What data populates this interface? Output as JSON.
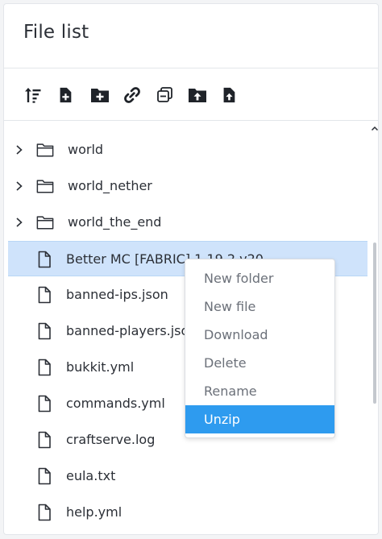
{
  "panel": {
    "title": "File list"
  },
  "toolbar": {
    "tools": [
      {
        "icon": "sort-icon"
      },
      {
        "icon": "new-file-icon"
      },
      {
        "icon": "new-folder-icon"
      },
      {
        "icon": "link-icon"
      },
      {
        "icon": "collapse-icon"
      },
      {
        "icon": "upload-folder-icon"
      },
      {
        "icon": "upload-file-icon"
      }
    ]
  },
  "files": [
    {
      "name": "world",
      "type": "folder"
    },
    {
      "name": "world_nether",
      "type": "folder"
    },
    {
      "name": "world_the_end",
      "type": "folder"
    },
    {
      "name": "Better MC [FABRIC] 1.19.2 v20....",
      "type": "file",
      "selected": true
    },
    {
      "name": "banned-ips.json",
      "type": "file"
    },
    {
      "name": "banned-players.json",
      "type": "file"
    },
    {
      "name": "bukkit.yml",
      "type": "file"
    },
    {
      "name": "commands.yml",
      "type": "file"
    },
    {
      "name": "craftserve.log",
      "type": "file"
    },
    {
      "name": "eula.txt",
      "type": "file"
    },
    {
      "name": "help.yml",
      "type": "file"
    }
  ],
  "context_menu": {
    "items": [
      {
        "label": "New folder"
      },
      {
        "label": "New file"
      },
      {
        "label": "Download"
      },
      {
        "label": "Delete"
      },
      {
        "label": "Rename"
      },
      {
        "label": "Unzip",
        "active": true
      }
    ]
  },
  "colors": {
    "selected_row": "#cfe3fb",
    "menu_active": "#2e9bef",
    "text": "#2b2f36"
  }
}
